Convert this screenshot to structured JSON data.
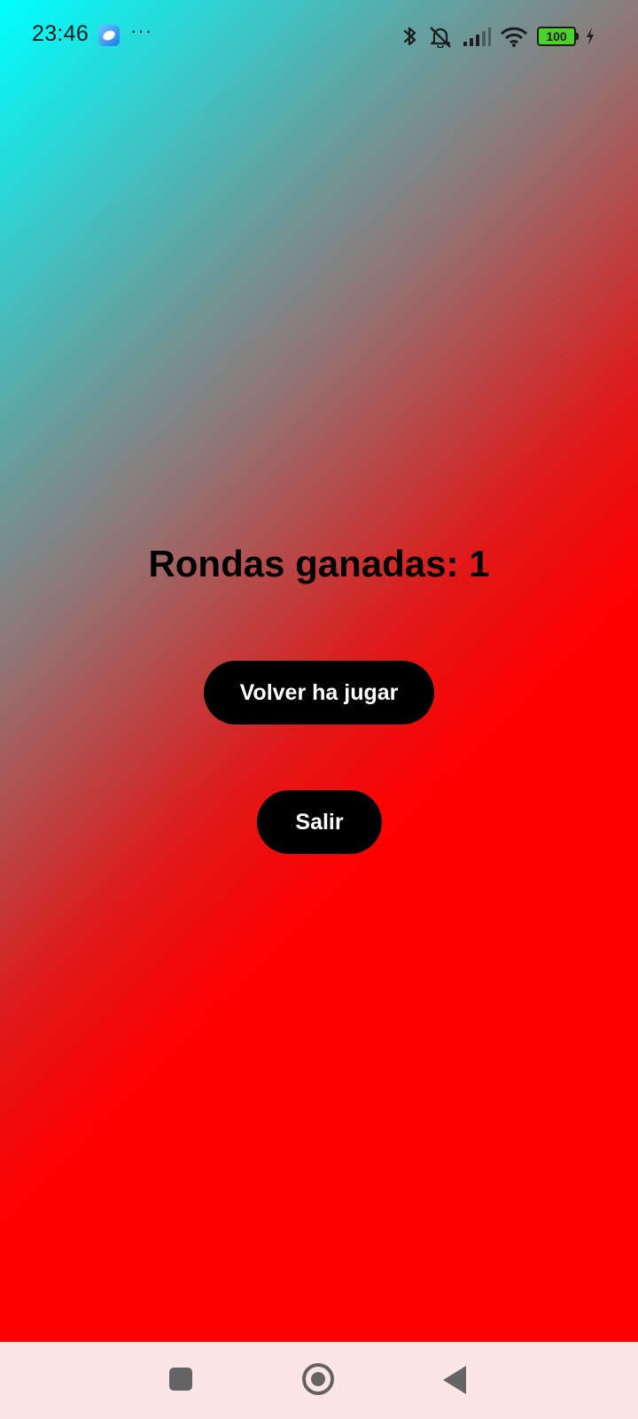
{
  "status_bar": {
    "time": "23:46",
    "notification_icons": [
      "app-notification-icon",
      "more-icon"
    ],
    "more": "···",
    "system_icons": [
      "bluetooth-icon",
      "vibrate-off-icon",
      "signal-icon",
      "wifi-icon",
      "battery-icon",
      "charging-icon"
    ],
    "battery_level": "100"
  },
  "main": {
    "rounds_label": "Rondas ganadas: 1",
    "replay_button": "Volver ha jugar",
    "exit_button": "Salir"
  },
  "nav_bar": {
    "buttons": [
      "recents-icon",
      "home-icon",
      "back-icon"
    ]
  },
  "colors": {
    "gradient_start": "#00ffff",
    "gradient_end": "#ff0000",
    "button_bg": "#000000",
    "button_text": "#ffffff",
    "nav_bar_bg": "#fce5e5"
  }
}
